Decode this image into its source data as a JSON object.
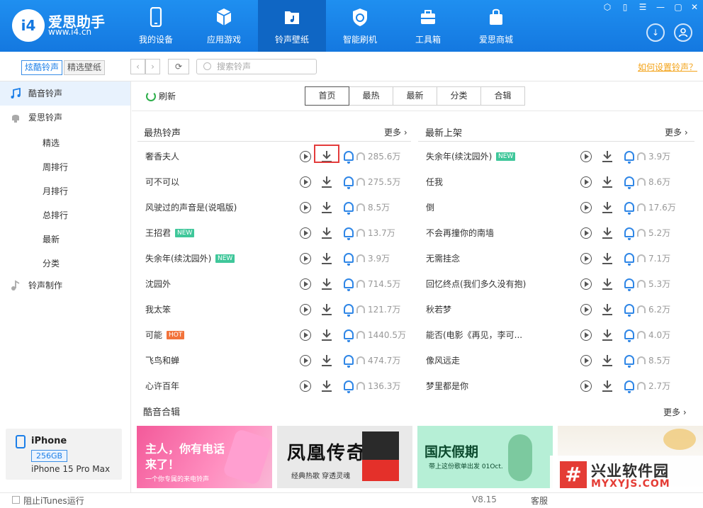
{
  "app": {
    "title": "爱思助手",
    "url": "www.i4.cn",
    "logo_text": "i4"
  },
  "nav": [
    {
      "label": "我的设备",
      "icon": "phone-icon"
    },
    {
      "label": "应用游戏",
      "icon": "cube-icon"
    },
    {
      "label": "铃声壁纸",
      "icon": "music-folder-icon"
    },
    {
      "label": "智能刷机",
      "icon": "refresh-shield-icon"
    },
    {
      "label": "工具箱",
      "icon": "toolbox-icon"
    },
    {
      "label": "爱思商城",
      "icon": "shopping-bag-icon"
    }
  ],
  "toolbar": {
    "seg_ringtone": "炫酷铃声",
    "seg_wallpaper": "精选壁纸",
    "search_placeholder": "搜索铃声",
    "howto_link": "如何设置铃声？"
  },
  "sidebar": {
    "items": [
      {
        "label": "酷音铃声"
      },
      {
        "label": "爱思铃声"
      }
    ],
    "sub_items": [
      "精选",
      "周排行",
      "月排行",
      "总排行",
      "最新",
      "分类"
    ],
    "make": "铃声制作"
  },
  "device": {
    "name": "iPhone",
    "capacity": "256GB",
    "model": "iPhone 15 Pro Max"
  },
  "content": {
    "refresh": "刷新",
    "tabs": [
      "首页",
      "最热",
      "最新",
      "分类",
      "合辑"
    ],
    "hot_title": "最热铃声",
    "new_title": "最新上架",
    "more": "更多",
    "hot": [
      {
        "name": "奢香夫人",
        "plays": "285.6万",
        "badge": ""
      },
      {
        "name": "可不可以",
        "plays": "275.5万",
        "badge": ""
      },
      {
        "name": "风驶过的声音是(说唱版)",
        "plays": "8.5万",
        "badge": ""
      },
      {
        "name": "王招君",
        "plays": "13.7万",
        "badge": "NEW"
      },
      {
        "name": "失余年(续沈园外)",
        "plays": "3.9万",
        "badge": "NEW"
      },
      {
        "name": "沈园外",
        "plays": "714.5万",
        "badge": ""
      },
      {
        "name": "我太笨",
        "plays": "121.7万",
        "badge": ""
      },
      {
        "name": "可能",
        "plays": "1440.5万",
        "badge": "HOT"
      },
      {
        "name": "飞鸟和蝉",
        "plays": "474.7万",
        "badge": ""
      },
      {
        "name": "心许百年",
        "plays": "136.3万",
        "badge": ""
      }
    ],
    "latest": [
      {
        "name": "失余年(续沈园外)",
        "plays": "3.9万",
        "badge": "NEW"
      },
      {
        "name": "任我",
        "plays": "8.6万",
        "badge": ""
      },
      {
        "name": "倒",
        "plays": "17.6万",
        "badge": ""
      },
      {
        "name": "不会再撞你的南墙",
        "plays": "5.2万",
        "badge": ""
      },
      {
        "name": "无需挂念",
        "plays": "7.1万",
        "badge": ""
      },
      {
        "name": "回忆终点(我们多久没有抱)",
        "plays": "5.3万",
        "badge": ""
      },
      {
        "name": "秋若梦",
        "plays": "6.2万",
        "badge": ""
      },
      {
        "name": "能否(电影《再见，李可...",
        "plays": "4.0万",
        "badge": ""
      },
      {
        "name": "像风远走",
        "plays": "8.5万",
        "badge": ""
      },
      {
        "name": "梦里都是你",
        "plays": "2.7万",
        "badge": ""
      }
    ],
    "albums_title": "酷音合辑",
    "albums": [
      {
        "title": "主人，你有电话来了！",
        "sub": "一个你专属的来电铃声"
      },
      {
        "title": "凤凰传奇",
        "sub": "经典热歌 穿透灵魂"
      },
      {
        "title": "国庆假期",
        "sub": "带上这份歌单出发 01Oct."
      },
      {
        "title": "",
        "sub": ""
      }
    ]
  },
  "footer": {
    "itunes": "阻止iTunes运行",
    "version": "V8.15",
    "service": "客服"
  },
  "watermark": {
    "t1": "兴业软件园",
    "t2": "MYXYJS.COM",
    "mark": "#"
  }
}
